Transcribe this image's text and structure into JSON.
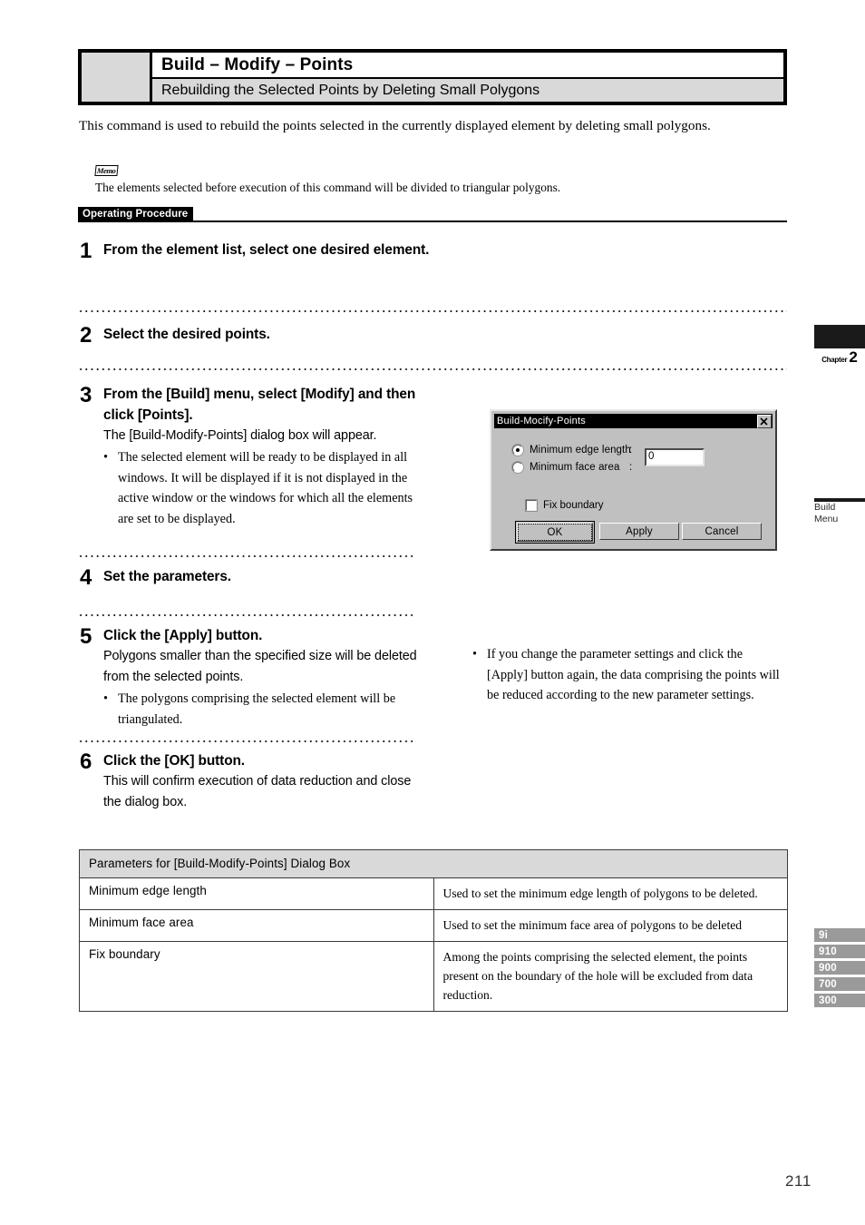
{
  "header": {
    "title": "Build – Modify – Points",
    "subtitle": "Rebuilding the Selected Points by Deleting Small Polygons"
  },
  "intro": {
    "paragraph": "This command is used to rebuild the points selected in the currently displayed element by deleting small polygons."
  },
  "memo": {
    "badge": "Memo",
    "text": "The elements selected before execution of this command will be divided to triangular polygons."
  },
  "operating_procedure": {
    "label": "Operating Procedure"
  },
  "steps": [
    {
      "number": "1",
      "heading": "From the element list, select  one desired element.",
      "sub": "",
      "bullets": []
    },
    {
      "number": "2",
      "heading": "Select the desired points.",
      "sub": "",
      "bullets": []
    },
    {
      "number": "3",
      "heading": "From the [Build] menu, select [Modify] and then click [Points].",
      "sub": "The [Build-Modify-Points] dialog box will appear.",
      "bullets": [
        "The selected element will be ready to be displayed in all windows. It will be displayed if it is not displayed in the active window or the windows for which all the elements are set to be displayed."
      ]
    },
    {
      "number": "4",
      "heading": "Set the parameters.",
      "sub": "",
      "bullets": []
    },
    {
      "number": "5",
      "heading": "Click the [Apply] button.",
      "sub": "Polygons smaller than the specified size will be deleted from the selected points.",
      "bullets": [
        "The polygons comprising the selected element will be triangulated."
      ]
    },
    {
      "number": "6",
      "heading": "Click the [OK] button.",
      "sub": "This will confirm execution of data reduction and close the dialog box.",
      "bullets": []
    }
  ],
  "side_note": {
    "bullet_mark": "•",
    "text": "If you change the parameter settings and click the [Apply] button again, the data comprising the points will be reduced according to the new parameter settings."
  },
  "dialog": {
    "title": "Build-Mocify-Points",
    "close_icon": "close-icon",
    "radio_options": [
      {
        "label": "Minimum edge length",
        "colon": ":",
        "selected": true
      },
      {
        "label": "Minimum face area",
        "colon": ":",
        "selected": false
      }
    ],
    "value_field": {
      "value": "0"
    },
    "checkbox": {
      "label": "Fix boundary",
      "checked": false
    },
    "buttons": [
      {
        "label": "OK",
        "default": true
      },
      {
        "label": "Apply",
        "default": false
      },
      {
        "label": "Cancel",
        "default": false
      }
    ]
  },
  "parameters_table": {
    "header": "Parameters for [Build-Modify-Points] Dialog Box",
    "rows": [
      {
        "name": "Minimum edge length",
        "description": "Used to set the minimum edge length of polygons to be deleted."
      },
      {
        "name": "Minimum face area",
        "description": "Used to set the minimum face area of polygons to be deleted"
      },
      {
        "name": "Fix boundary",
        "description": "Among the points comprising the selected element, the points present on the boundary of the hole will be excluded from data reduction."
      }
    ]
  },
  "margin": {
    "chapter_word": "Chapter",
    "chapter_number": "2",
    "menu_line1": "Build",
    "menu_line2": "Menu",
    "model_tabs": [
      "9i",
      "910",
      "900",
      "700",
      "300"
    ]
  },
  "page_number": "211",
  "colors": {
    "header_gray": "#d9d9d9",
    "band_black": "#000000",
    "dialog_face": "#c0c0c0",
    "tab_gray": "#9a9a9a"
  },
  "bullet_mark": "•"
}
